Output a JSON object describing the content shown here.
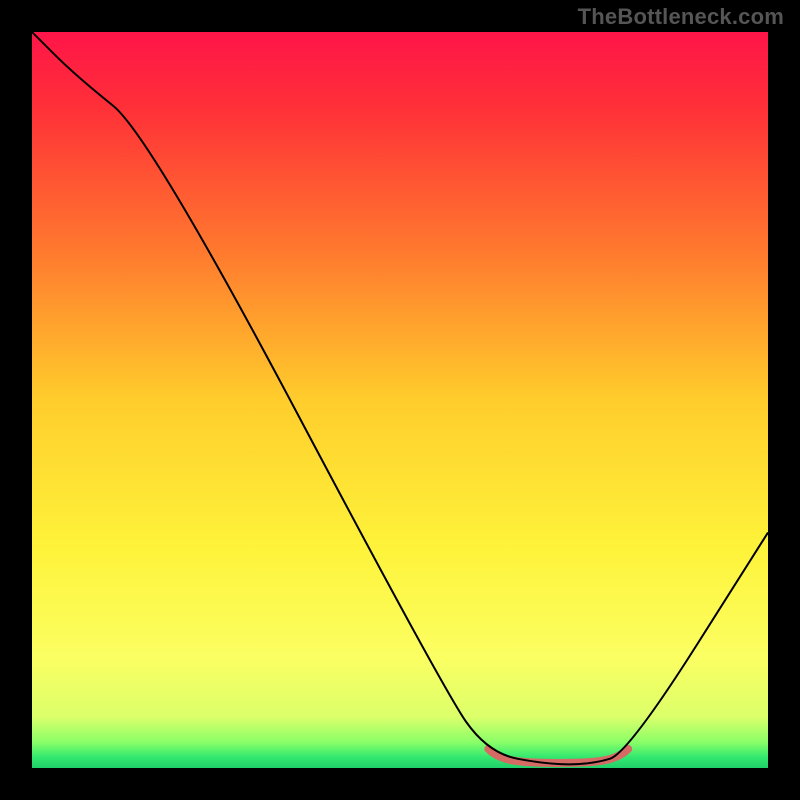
{
  "watermark": "TheBottleneck.com",
  "chart_data": {
    "type": "line",
    "title": "",
    "xlabel": "",
    "ylabel": "",
    "xlim": [
      0,
      100
    ],
    "ylim": [
      0,
      100
    ],
    "series": [
      {
        "name": "curve",
        "x": [
          0,
          6,
          16,
          56,
          62,
          70,
          76,
          81,
          100
        ],
        "values": [
          100,
          94,
          86,
          10.5,
          2,
          0.5,
          0.5,
          2,
          32
        ]
      }
    ],
    "gradient_stops": [
      {
        "offset": 0,
        "color": "#ff1549"
      },
      {
        "offset": 0.1,
        "color": "#ff2f38"
      },
      {
        "offset": 0.3,
        "color": "#ff7a2e"
      },
      {
        "offset": 0.5,
        "color": "#ffcd2c"
      },
      {
        "offset": 0.7,
        "color": "#fef33a"
      },
      {
        "offset": 0.85,
        "color": "#fbff62"
      },
      {
        "offset": 0.93,
        "color": "#dcff6a"
      },
      {
        "offset": 0.965,
        "color": "#8aff68"
      },
      {
        "offset": 0.985,
        "color": "#33e86f"
      },
      {
        "offset": 1.0,
        "color": "#1fcf6a"
      }
    ],
    "marker_band": {
      "x": [
        62,
        81
      ],
      "y_offset_pct": 1.5,
      "color": "#d66a65",
      "width": 8
    }
  }
}
